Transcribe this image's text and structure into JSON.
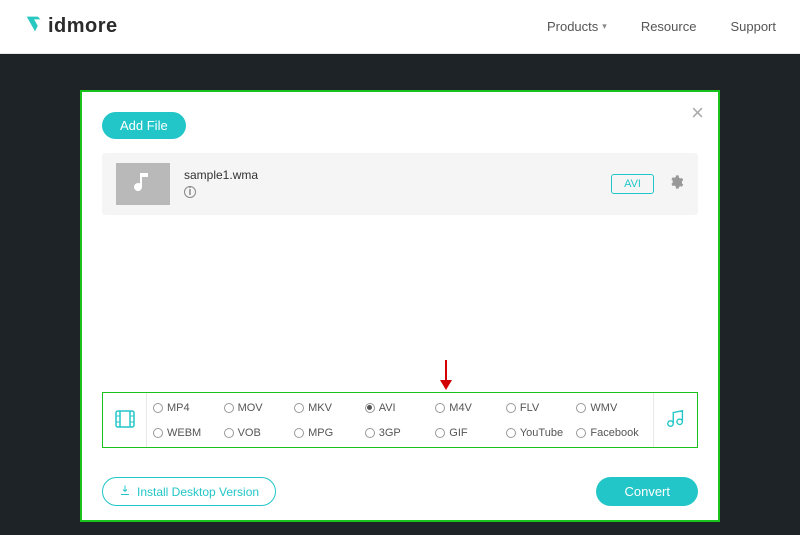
{
  "header": {
    "logo_text": "idmore",
    "nav": {
      "products": "Products",
      "resource": "Resource",
      "support": "Support"
    }
  },
  "modal": {
    "add_file_label": "Add File",
    "file": {
      "name": "sample1.wma",
      "output_tag": "AVI"
    },
    "install_label": "Install Desktop Version",
    "convert_label": "Convert"
  },
  "formats": {
    "selected": "AVI",
    "row1": [
      "MP4",
      "MOV",
      "MKV",
      "AVI",
      "M4V",
      "FLV",
      "WMV"
    ],
    "row2": [
      "WEBM",
      "VOB",
      "MPG",
      "3GP",
      "GIF",
      "YouTube",
      "Facebook"
    ]
  }
}
